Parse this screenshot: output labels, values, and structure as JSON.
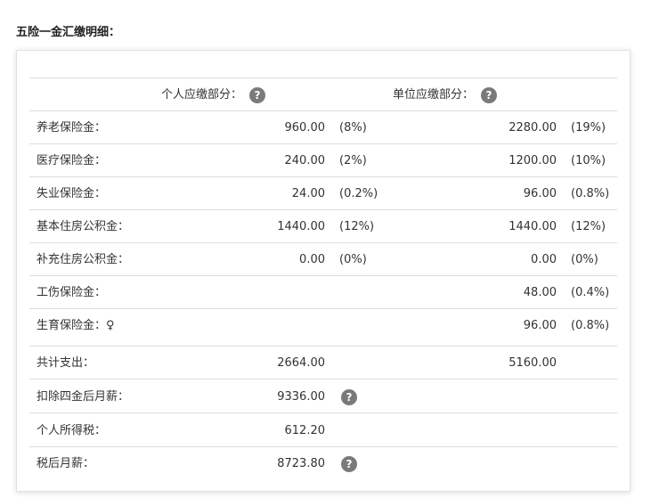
{
  "section_title": "五险一金汇缴明细：",
  "help_glyph": "?",
  "headers": {
    "personal": "个人应缴部分：",
    "company": "单位应缴部分："
  },
  "rows": [
    {
      "label": "养老保险金：",
      "personal_amount": "960.00",
      "personal_rate": "(8%)",
      "company_amount": "2280.00",
      "company_rate": "(19%)"
    },
    {
      "label": "医疗保险金：",
      "personal_amount": "240.00",
      "personal_rate": "(2%)",
      "company_amount": "1200.00",
      "company_rate": "(10%)"
    },
    {
      "label": "失业保险金：",
      "personal_amount": "24.00",
      "personal_rate": "(0.2%)",
      "company_amount": "96.00",
      "company_rate": "(0.8%)"
    },
    {
      "label": "基本住房公积金：",
      "personal_amount": "1440.00",
      "personal_rate": "(12%)",
      "company_amount": "1440.00",
      "company_rate": "(12%)"
    },
    {
      "label": "补充住房公积金：",
      "personal_amount": "0.00",
      "personal_rate": "(0%)",
      "company_amount": "0.00",
      "company_rate": "(0%)"
    },
    {
      "label": "工伤保险金：",
      "personal_amount": "",
      "personal_rate": "",
      "company_amount": "48.00",
      "company_rate": "(0.4%)"
    },
    {
      "label": "生育保险金：♀",
      "personal_amount": "",
      "personal_rate": "",
      "company_amount": "96.00",
      "company_rate": "(0.8%)"
    }
  ],
  "summary": [
    {
      "label": "共计支出：",
      "personal_amount": "2664.00",
      "company_amount": "5160.00",
      "has_help": false
    },
    {
      "label": "扣除四金后月薪：",
      "personal_amount": "9336.00",
      "company_amount": "",
      "has_help": true
    },
    {
      "label": "个人所得税：",
      "personal_amount": "612.20",
      "company_amount": "",
      "has_help": false
    },
    {
      "label": "税后月薪：",
      "personal_amount": "8723.80",
      "company_amount": "",
      "has_help": true
    }
  ]
}
